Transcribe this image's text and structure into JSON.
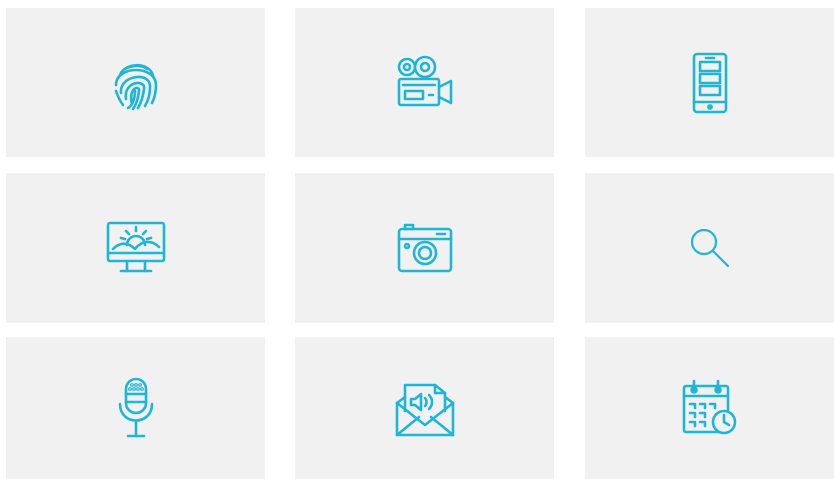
{
  "theme": {
    "icon_color": "#1fb6d5",
    "tile_color": "#f1f1f1",
    "background": "#ffffff"
  },
  "icons": [
    {
      "name": "fingerprint-icon"
    },
    {
      "name": "video-camera-icon"
    },
    {
      "name": "mobile-phone-icon"
    },
    {
      "name": "monitor-landscape-icon"
    },
    {
      "name": "photo-camera-icon"
    },
    {
      "name": "search-icon"
    },
    {
      "name": "microphone-icon"
    },
    {
      "name": "audio-message-envelope-icon"
    },
    {
      "name": "calendar-clock-icon"
    }
  ]
}
